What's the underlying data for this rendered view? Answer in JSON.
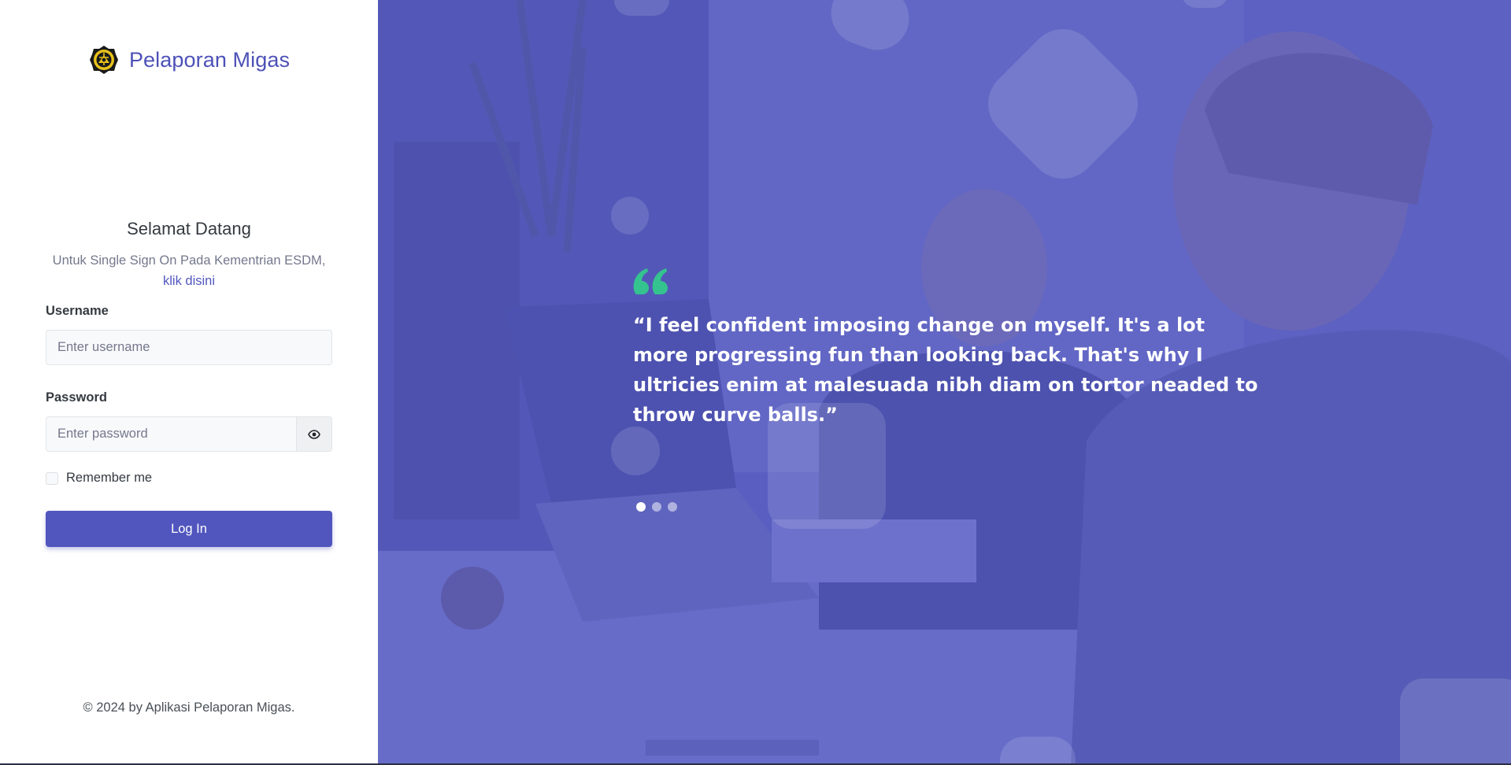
{
  "brand": {
    "name": "Pelaporan Migas",
    "logo_icon": "esdm-emblem-icon"
  },
  "welcome": {
    "title": "Selamat Datang",
    "subtitle": "Untuk Single Sign On Pada Kementrian ESDM,",
    "link_text": "klik disini"
  },
  "form": {
    "username_label": "Username",
    "username_placeholder": "Enter username",
    "username_value": "",
    "password_label": "Password",
    "password_placeholder": "Enter password",
    "password_value": "",
    "password_toggle_icon": "eye-icon",
    "remember_label": "Remember me",
    "remember_checked": false,
    "login_label": "Log In"
  },
  "footer": {
    "text": "© 2024 by Aplikasi Pelaporan Migas."
  },
  "testimonial": {
    "quote_icon": "quote-icon",
    "text": "“I feel confident imposing change on myself. It's a lot more progressing fun than looking back. That's why I ultricies enim at malesuada nibh diam on tortor neaded to throw curve balls.”",
    "slide_count": 3,
    "active_slide": 1
  },
  "colors": {
    "brand": "#4d51b7",
    "primary": "#5156be",
    "overlay": "#555ac4",
    "quote_icon": "#34c38f"
  }
}
